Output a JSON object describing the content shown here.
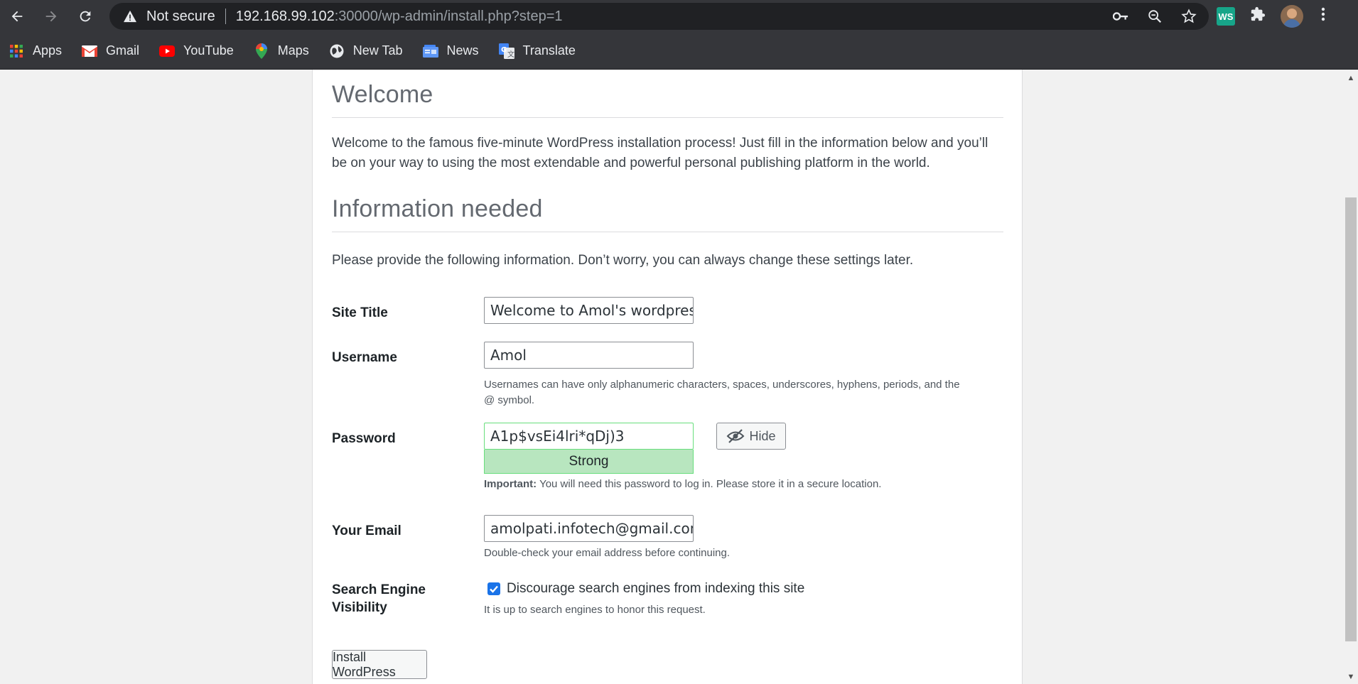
{
  "browser": {
    "security_label": "Not secure",
    "url_host": "192.168.99.102",
    "url_path": ":30000/wp-admin/install.php?step=1",
    "bookmarks": [
      {
        "label": "Apps",
        "icon": "apps-grid-icon"
      },
      {
        "label": "Gmail",
        "icon": "gmail-icon"
      },
      {
        "label": "YouTube",
        "icon": "youtube-icon"
      },
      {
        "label": "Maps",
        "icon": "maps-icon"
      },
      {
        "label": "New Tab",
        "icon": "globe-icon"
      },
      {
        "label": "News",
        "icon": "news-icon"
      },
      {
        "label": "Translate",
        "icon": "translate-icon"
      }
    ],
    "extension_label": "WS"
  },
  "page": {
    "welcome_heading": "Welcome",
    "welcome_text": "Welcome to the famous five-minute WordPress installation process! Just fill in the information below and you’ll be on your way to using the most extendable and powerful personal publishing platform in the world.",
    "info_heading": "Information needed",
    "info_text": "Please provide the following information. Don’t worry, you can always change these settings later.",
    "site_title_label": "Site Title",
    "site_title_value": "Welcome to Amol's wordpress",
    "username_label": "Username",
    "username_value": "Amol",
    "username_hint": "Usernames can have only alphanumeric characters, spaces, underscores, hyphens, periods, and the @ symbol.",
    "password_label": "Password",
    "password_value": "A1p$vsEi4lri*qDj)3",
    "password_strength": "Strong",
    "hide_label": "Hide",
    "password_important": "Important:",
    "password_hint": "You will need this password to log in. Please store it in a secure location.",
    "email_label": "Your Email",
    "email_value": "amolpati.infotech@gmail.com",
    "email_hint": "Double-check your email address before continuing.",
    "visibility_label": "Search Engine Visibility",
    "visibility_checkbox_label": "Discourage search engines from indexing this site",
    "visibility_checked": true,
    "visibility_hint": "It is up to search engines to honor this request.",
    "install_button": "Install WordPress"
  },
  "colors": {
    "chrome_bg": "#35363a",
    "strength_good": "#b8e6bf",
    "checkbox_accent": "#1a73e8"
  }
}
